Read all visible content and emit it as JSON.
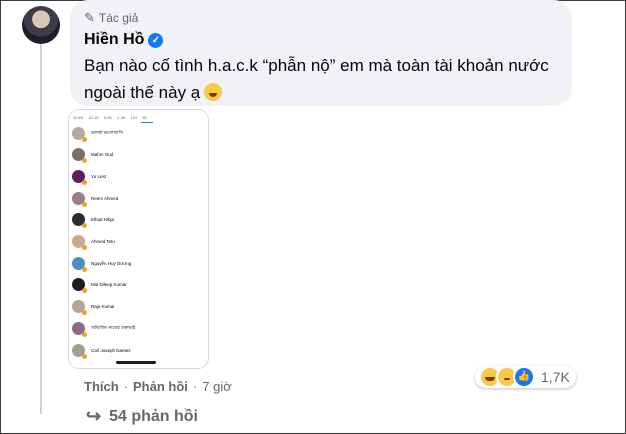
{
  "comment": {
    "author_badge": "Tác giả",
    "author_name": "Hiền Hồ",
    "text": "Bạn nào cố tình h.a.c.k “phẫn nộ” em mà toàn tài khoản nước ngoài thế này ạ",
    "time": "7 giờ",
    "actions": {
      "like": "Thích",
      "reply": "Phản hồi"
    },
    "reaction_count": "1,7K",
    "reactions": [
      "haha-icon",
      "sad-icon",
      "like-icon"
    ],
    "replies_label": "54 phản hồi"
  },
  "screenshot": {
    "reaction_tabs": [
      "10,6K",
      "10,1K",
      "5,5K",
      "2,3K",
      "124",
      "36"
    ],
    "rows": [
      {
        "name": "ডলারু ভালোবাসি",
        "color": "#b8a9a0"
      },
      {
        "name": "Mahm Oud",
        "color": "#7c6f66"
      },
      {
        "name": "Yu Lest",
        "color": "#5b1d5c"
      },
      {
        "name": "Reem Ahmed",
        "color": "#9a7e8e"
      },
      {
        "name": "Elhad Hibja",
        "color": "#2e2b2a"
      },
      {
        "name": "Ahmed Tetu",
        "color": "#c9a98a"
      },
      {
        "name": "Nguyễn Huy Dương",
        "color": "#4c8fc1"
      },
      {
        "name": "Mia Dileep Kumar",
        "color": "#1e1e22"
      },
      {
        "name": "Raja Kumar",
        "color": "#b5a394"
      },
      {
        "name": "অভিজিৎ নাথের গুরুভাই",
        "color": "#8e6a8a"
      },
      {
        "name": "Carl Joseph Dantes",
        "color": "#a79e93"
      }
    ]
  }
}
